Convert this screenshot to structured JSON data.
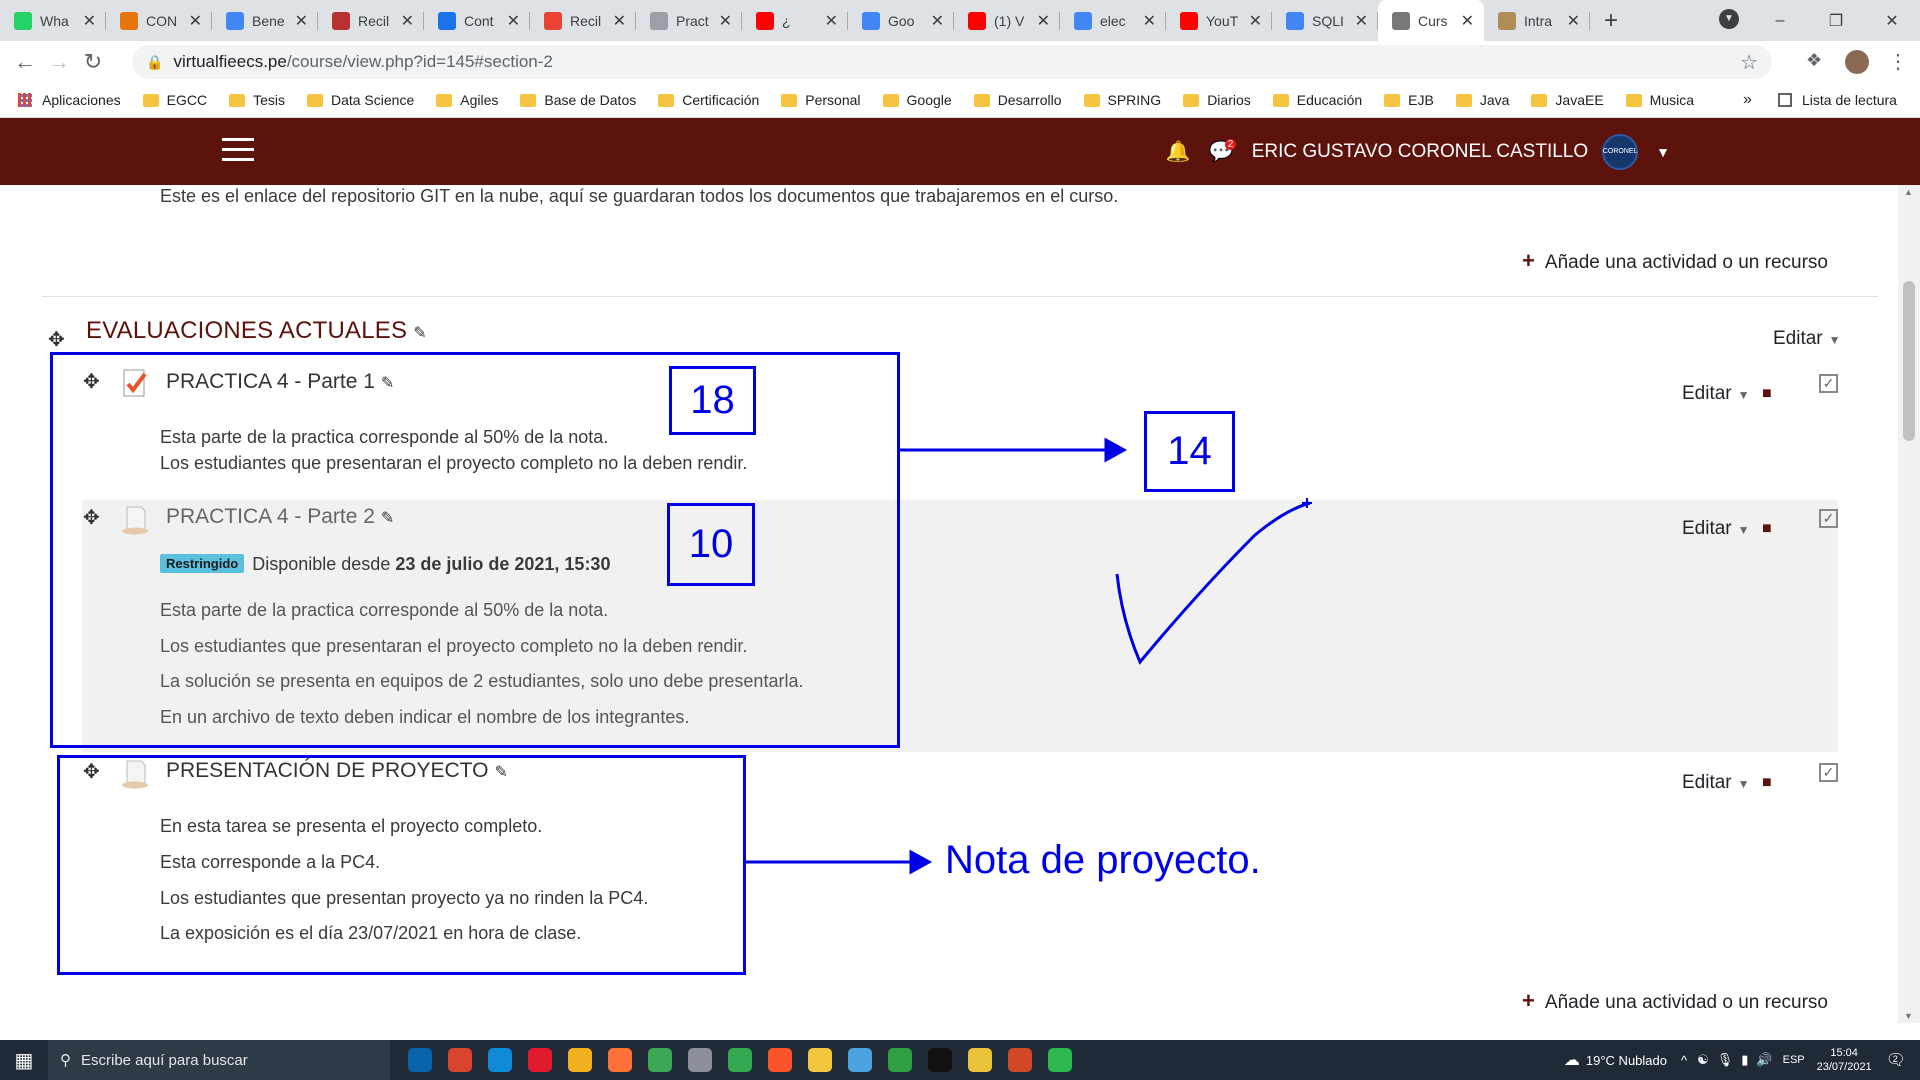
{
  "tabs": [
    {
      "title": "Wha",
      "icon": "whatsapp-icon",
      "color": "#25d366"
    },
    {
      "title": "CON",
      "icon": "bird-icon",
      "color": "#e8740c"
    },
    {
      "title": "Bene",
      "icon": "drive-icon",
      "color": "#4285f4"
    },
    {
      "title": "Recil",
      "icon": "doc-icon",
      "color": "#b8312f"
    },
    {
      "title": "Cont",
      "icon": "contacts-icon",
      "color": "#1a73e8"
    },
    {
      "title": "Recil",
      "icon": "gmail-icon",
      "color": "#ea4335"
    },
    {
      "title": "Pract",
      "icon": "globe-icon",
      "color": "#9aa0a6"
    },
    {
      "title": "¿",
      "icon": "youtube-icon",
      "color": "#ff0000"
    },
    {
      "title": "Goo",
      "icon": "translate-icon",
      "color": "#4285f4"
    },
    {
      "title": "(1) V",
      "icon": "youtube-icon",
      "color": "#ff0000"
    },
    {
      "title": "elec",
      "icon": "google-icon",
      "color": "#4285f4"
    },
    {
      "title": "YouT",
      "icon": "youtube-icon",
      "color": "#ff0000"
    },
    {
      "title": "SQLI",
      "icon": "google-icon",
      "color": "#4285f4"
    },
    {
      "title": "Curs",
      "icon": "moodle-icon",
      "color": "#777777",
      "active": true
    },
    {
      "title": "Intra",
      "icon": "intranet-icon",
      "color": "#b08d57"
    }
  ],
  "address": {
    "domain": "virtualfieecs.pe",
    "path": "/course/view.php?id=145#section-2"
  },
  "bookmarks": {
    "apps": "Aplicaciones",
    "items": [
      "EGCC",
      "Tesis",
      "Data Science",
      "Agiles",
      "Base de Datos",
      "Certificación",
      "Personal",
      "Google",
      "Desarrollo",
      "SPRING",
      "Diarios",
      "Educación",
      "EJB",
      "Java",
      "JavaEE",
      "Musica"
    ],
    "more": "»",
    "reading_list": "Lista de lectura"
  },
  "navbar": {
    "user_name": "ERIC GUSTAVO CORONEL CASTILLO",
    "message_badge": "2",
    "avatar_text": "CORONEL",
    "bg_color": "#5c130c"
  },
  "content": {
    "intro_text": "Este es el enlace del repositorio GIT en la nube, aquí se guardaran todos los documentos que trabajaremos en el curso.",
    "add_activity": "Añade una actividad o un recurso",
    "section_title": "EVALUACIONES ACTUALES",
    "section_edit": "Editar",
    "activities": [
      {
        "name": "PRACTICA 4 - Parte 1",
        "edit": "Editar",
        "lines": [
          "Esta parte de la practica corresponde al 50% de la nota.",
          "Los estudiantes que presentaran el proyecto completo no la deben rendir."
        ]
      },
      {
        "name": "PRACTICA 4 - Parte 2",
        "edit": "Editar",
        "restricted_badge": "Restringido",
        "available_prefix": "Disponible desde",
        "available_date": "23 de julio de 2021, 15:30",
        "lines": [
          "Esta parte de la practica corresponde al 50% de la nota.",
          "Los estudiantes que presentaran el proyecto completo no la deben rendir.",
          "La solución se presenta en equipos de 2 estudiantes, solo uno debe presentarla.",
          "En un archivo de texto deben indicar el nombre de los integrantes."
        ]
      },
      {
        "name": "PRESENTACIÓN DE PROYECTO",
        "edit": "Editar",
        "lines": [
          "En esta tarea se presenta el proyecto completo.",
          "Esta corresponde a la PC4.",
          "Los estudiantes que presentan proyecto ya no rinden la PC4.",
          "La exposición es el día 23/07/2021 en hora de clase."
        ]
      }
    ]
  },
  "annotations": {
    "grade_part1": "18",
    "grade_part2": "10",
    "grade_average": "14",
    "project_note": "Nota de proyecto.",
    "color": "#0000e6"
  },
  "taskbar": {
    "search_placeholder": "Escribe aquí para buscar",
    "weather": "19°C  Nublado",
    "lang": "ESP",
    "time": "15:04",
    "date": "23/07/2021",
    "notif_count": "2"
  }
}
